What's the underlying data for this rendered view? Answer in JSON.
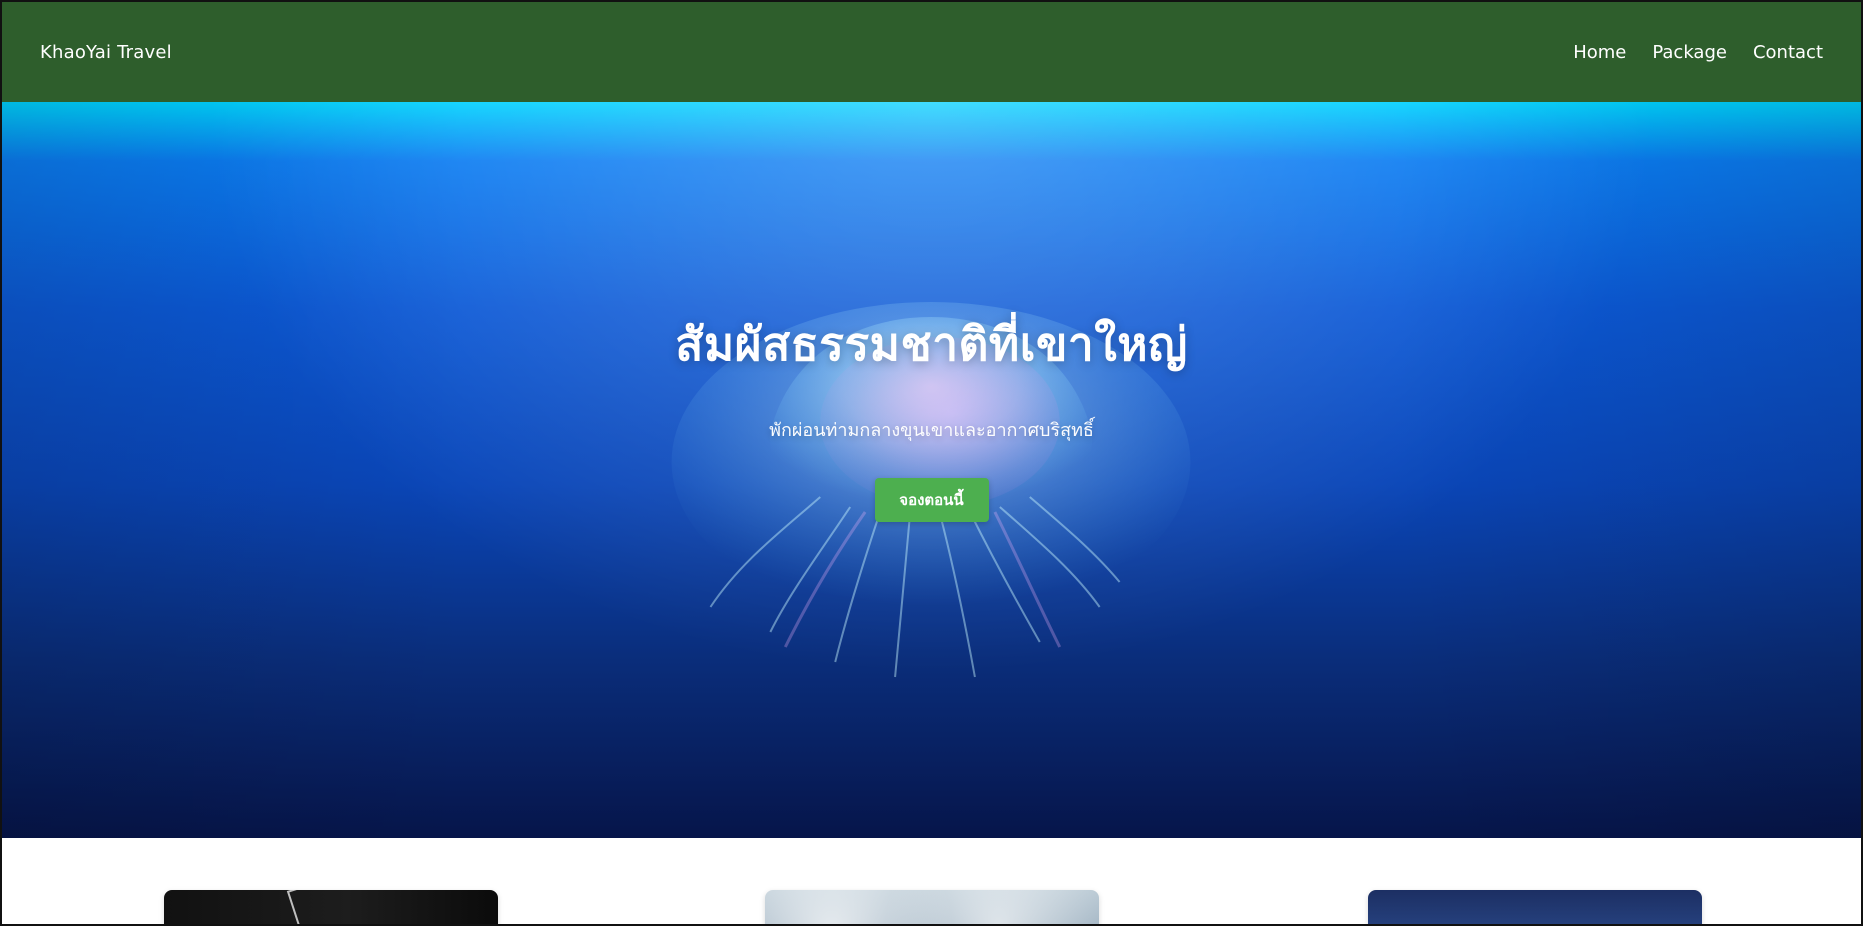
{
  "header": {
    "brand": "KhaoYai Travel",
    "nav": [
      {
        "label": "Home"
      },
      {
        "label": "Package"
      },
      {
        "label": "Contact"
      }
    ]
  },
  "hero": {
    "title": "สัมผัสธรรมชาติที่เขาใหญ่",
    "subtitle": "พักผ่อนท่ามกลางขุนเขาและอากาศบริสุทธิ์",
    "cta_label": "จองตอนนี้"
  },
  "colors": {
    "header_bg": "#2e5e2c",
    "cta_bg": "#4daf4f",
    "hero_top": "#00d2ff",
    "hero_bottom": "#06154a",
    "text": "#ffffff"
  },
  "icons": {
    "hero_decor": "jellyfish-illustration"
  }
}
